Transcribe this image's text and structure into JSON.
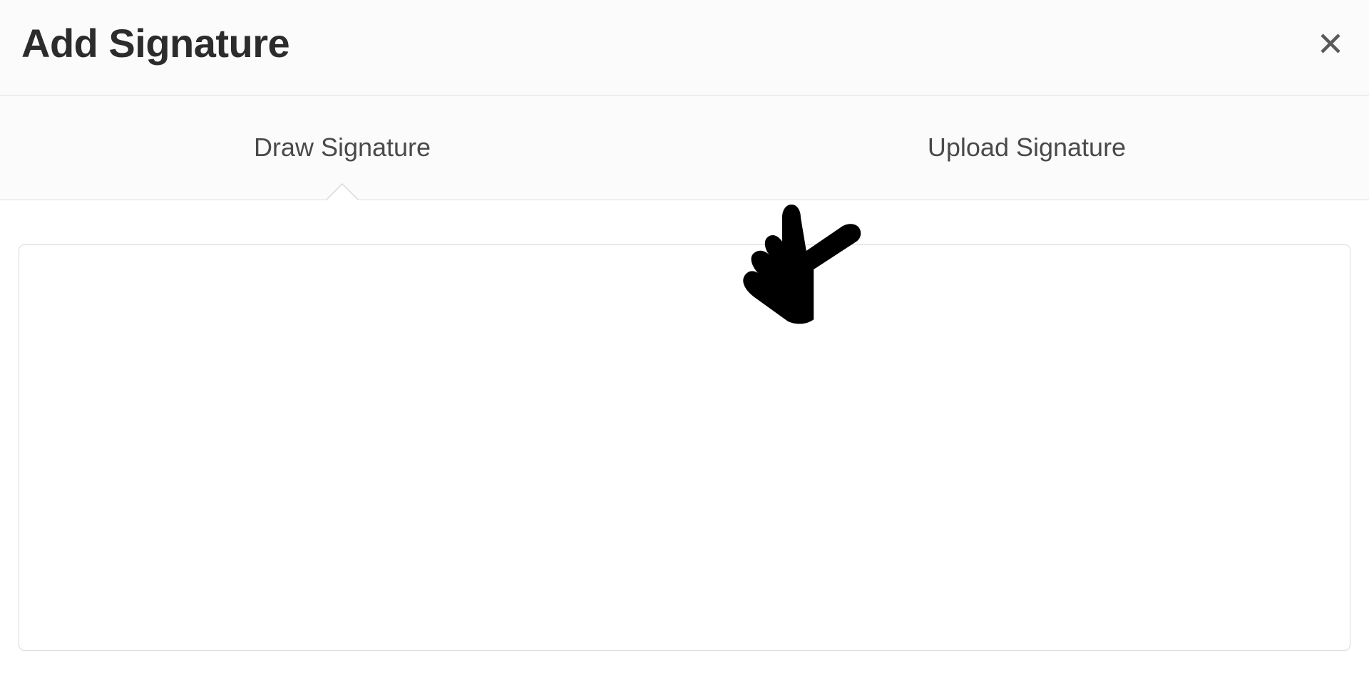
{
  "dialog": {
    "title": "Add Signature"
  },
  "tabs": {
    "draw": {
      "label": "Draw Signature",
      "active": true
    },
    "upload": {
      "label": "Upload Signature",
      "active": false
    }
  },
  "icons": {
    "close": "close-icon",
    "pointing_hand": "pointing-hand-icon"
  }
}
